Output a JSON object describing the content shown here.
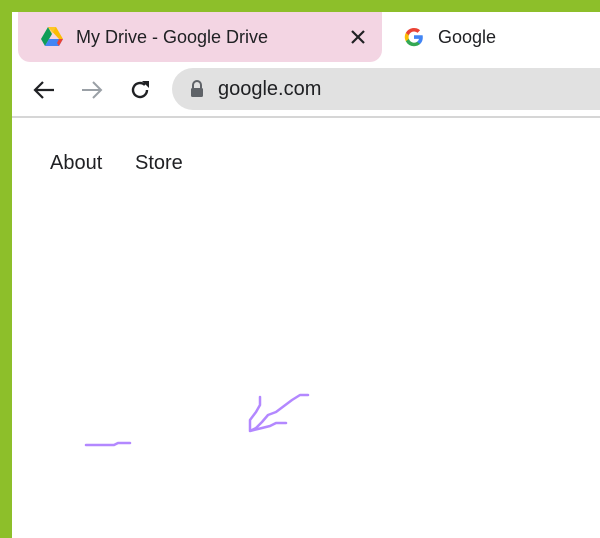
{
  "tabs": [
    {
      "title": "My Drive - Google Drive",
      "icon": "google-drive-icon",
      "active": true
    },
    {
      "title": "Google",
      "icon": "google-g-icon",
      "active": false
    }
  ],
  "toolbar": {
    "back_icon": "back-arrow-icon",
    "forward_icon": "forward-arrow-icon",
    "reload_icon": "reload-icon",
    "lock_icon": "lock-icon",
    "url": "google.com"
  },
  "page": {
    "links": [
      "About",
      "Store"
    ]
  },
  "colors": {
    "frame": "#8dbf2a",
    "active_tab": "#f3d5e3",
    "omnibox": "#e1e1e1",
    "ink": "#b388ff"
  }
}
